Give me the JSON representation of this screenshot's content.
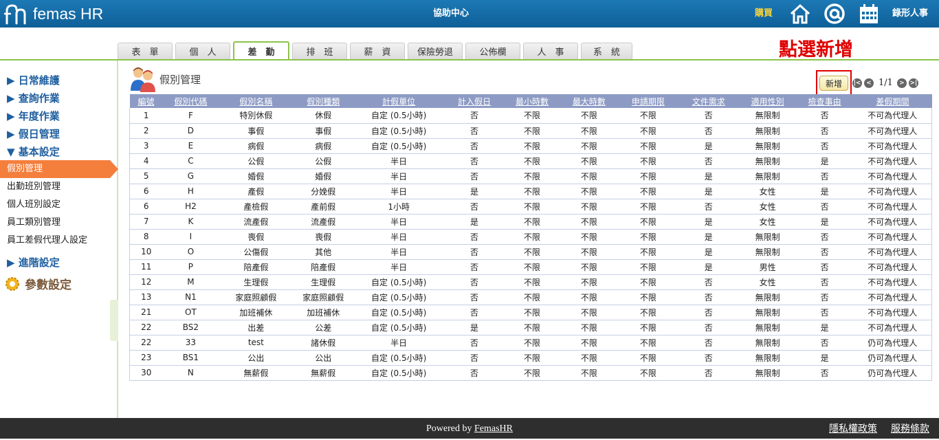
{
  "app": {
    "logo_text": "femas HR",
    "help_center": "協助中心",
    "buy": "購買",
    "user": "錄形人事",
    "icons": [
      "home-icon",
      "mail-at-icon",
      "calendar-icon"
    ]
  },
  "tabs": [
    {
      "label": "表　單"
    },
    {
      "label": "個　人"
    },
    {
      "label": "差　勤"
    },
    {
      "label": "排　班"
    },
    {
      "label": "薪　資"
    },
    {
      "label": "保險勞退"
    },
    {
      "label": "公佈欄"
    },
    {
      "label": "人　事"
    },
    {
      "label": "系　統"
    }
  ],
  "hint": "點選新增",
  "sidebar": {
    "groups": [
      "▶ 日常維護",
      "▶ 查詢作業",
      "▶ 年度作業",
      "▶ 假日管理",
      "▼ 基本設定"
    ],
    "items": [
      "假別管理",
      "出勤班別管理",
      "個人班別設定",
      "員工類別管理",
      "員工差假代理人設定"
    ],
    "advanced": "▶ 進階設定",
    "param": "參數設定"
  },
  "main": {
    "title": "假別管理",
    "add_button": "新增",
    "pager": "1/1"
  },
  "table": {
    "headers": [
      "編號",
      "假別代碼",
      "假別名稱",
      "假別種類",
      "計假單位",
      "計入假日",
      "最小時數",
      "最大時數",
      "申請期限",
      "文件需求",
      "適用性別",
      "檢查事由",
      "差假期間"
    ],
    "rows": [
      [
        "1",
        "F",
        "特別休假",
        "休假",
        "自定 (0.5小時)",
        "否",
        "不限",
        "不限",
        "不限",
        "否",
        "無限制",
        "否",
        "不可為代理人"
      ],
      [
        "2",
        "D",
        "事假",
        "事假",
        "自定 (0.5小時)",
        "否",
        "不限",
        "不限",
        "不限",
        "否",
        "無限制",
        "否",
        "不可為代理人"
      ],
      [
        "3",
        "E",
        "病假",
        "病假",
        "自定 (0.5小時)",
        "否",
        "不限",
        "不限",
        "不限",
        "是",
        "無限制",
        "否",
        "不可為代理人"
      ],
      [
        "4",
        "C",
        "公假",
        "公假",
        "半日",
        "否",
        "不限",
        "不限",
        "不限",
        "否",
        "無限制",
        "是",
        "不可為代理人"
      ],
      [
        "5",
        "G",
        "婚假",
        "婚假",
        "半日",
        "否",
        "不限",
        "不限",
        "不限",
        "是",
        "無限制",
        "否",
        "不可為代理人"
      ],
      [
        "6",
        "H",
        "產假",
        "分娩假",
        "半日",
        "是",
        "不限",
        "不限",
        "不限",
        "是",
        "女性",
        "是",
        "不可為代理人"
      ],
      [
        "6",
        "H2",
        "產檢假",
        "產前假",
        "1小時",
        "否",
        "不限",
        "不限",
        "不限",
        "否",
        "女性",
        "否",
        "不可為代理人"
      ],
      [
        "7",
        "K",
        "流產假",
        "流產假",
        "半日",
        "是",
        "不限",
        "不限",
        "不限",
        "是",
        "女性",
        "是",
        "不可為代理人"
      ],
      [
        "8",
        "I",
        "喪假",
        "喪假",
        "半日",
        "否",
        "不限",
        "不限",
        "不限",
        "是",
        "無限制",
        "否",
        "不可為代理人"
      ],
      [
        "10",
        "O",
        "公傷假",
        "其他",
        "半日",
        "否",
        "不限",
        "不限",
        "不限",
        "是",
        "無限制",
        "否",
        "不可為代理人"
      ],
      [
        "11",
        "P",
        "陪產假",
        "陪產假",
        "半日",
        "否",
        "不限",
        "不限",
        "不限",
        "是",
        "男性",
        "否",
        "不可為代理人"
      ],
      [
        "12",
        "M",
        "生理假",
        "生理假",
        "自定 (0.5小時)",
        "否",
        "不限",
        "不限",
        "不限",
        "否",
        "女性",
        "否",
        "不可為代理人"
      ],
      [
        "13",
        "N1",
        "家庭照顧假",
        "家庭照顧假",
        "自定 (0.5小時)",
        "否",
        "不限",
        "不限",
        "不限",
        "否",
        "無限制",
        "否",
        "不可為代理人"
      ],
      [
        "21",
        "OT",
        "加班補休",
        "加班補休",
        "自定 (0.5小時)",
        "否",
        "不限",
        "不限",
        "不限",
        "否",
        "無限制",
        "否",
        "不可為代理人"
      ],
      [
        "22",
        "BS2",
        "出差",
        "公差",
        "自定 (0.5小時)",
        "是",
        "不限",
        "不限",
        "不限",
        "否",
        "無限制",
        "是",
        "不可為代理人"
      ],
      [
        "22",
        "33",
        "test",
        "諸休假",
        "半日",
        "否",
        "不限",
        "不限",
        "不限",
        "否",
        "無限制",
        "否",
        "仍可為代理人"
      ],
      [
        "23",
        "BS1",
        "公出",
        "公出",
        "自定 (0.5小時)",
        "否",
        "不限",
        "不限",
        "不限",
        "否",
        "無限制",
        "是",
        "仍可為代理人"
      ],
      [
        "30",
        "N",
        "無薪假",
        "無薪假",
        "自定 (0.5小時)",
        "否",
        "不限",
        "不限",
        "不限",
        "否",
        "無限制",
        "否",
        "仍可為代理人"
      ]
    ]
  },
  "footer": {
    "powered_prefix": "Powered by ",
    "powered_link": "FemasHR",
    "privacy": "隱私權政策",
    "terms": "服務條款"
  },
  "colors": {
    "topbar": "#1570ab",
    "accent_green": "#8bc34a",
    "active_orange": "#f47f3d",
    "header_blue": "#8d9bc4",
    "hint_red": "#e00000"
  }
}
